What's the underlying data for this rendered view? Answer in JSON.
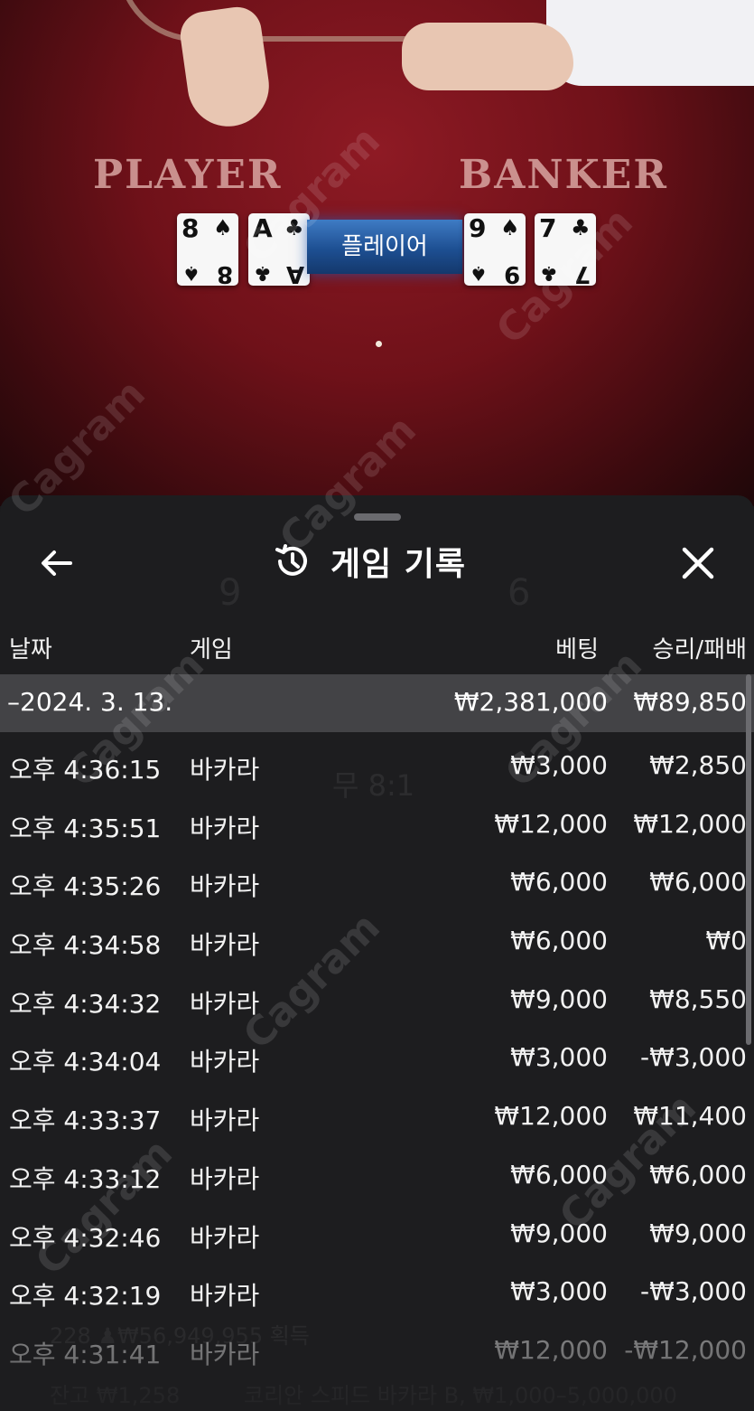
{
  "table": {
    "player_label": "PLAYER",
    "banker_label": "BANKER",
    "result_banner": "플레이어",
    "player_cards": [
      {
        "rank": "8",
        "suit": "♠"
      },
      {
        "rank": "A",
        "suit": "♣"
      }
    ],
    "banker_cards": [
      {
        "rank": "9",
        "suit": "♠"
      },
      {
        "rank": "7",
        "suit": "♣"
      }
    ],
    "watermark_text": "Cagram"
  },
  "sheet": {
    "title": "게임 기록",
    "icons": {
      "back": "arrow-left-icon",
      "history": "history-icon",
      "close": "close-icon"
    },
    "columns": {
      "date": "날짜",
      "game": "게임",
      "bet": "베팅",
      "result": "승리/패배"
    },
    "group": {
      "date": "–2024. 3. 13.",
      "bet": "₩2,381,000",
      "result": "₩89,850"
    },
    "rows": [
      {
        "time": "오후 4:36:15",
        "game": "바카라",
        "bet": "₩3,000",
        "result": "₩2,850"
      },
      {
        "time": "오후 4:35:51",
        "game": "바카라",
        "bet": "₩12,000",
        "result": "₩12,000"
      },
      {
        "time": "오후 4:35:26",
        "game": "바카라",
        "bet": "₩6,000",
        "result": "₩6,000"
      },
      {
        "time": "오후 4:34:58",
        "game": "바카라",
        "bet": "₩6,000",
        "result": "₩0"
      },
      {
        "time": "오후 4:34:32",
        "game": "바카라",
        "bet": "₩9,000",
        "result": "₩8,550"
      },
      {
        "time": "오후 4:34:04",
        "game": "바카라",
        "bet": "₩3,000",
        "result": "-₩3,000"
      },
      {
        "time": "오후 4:33:37",
        "game": "바카라",
        "bet": "₩12,000",
        "result": "₩11,400"
      },
      {
        "time": "오후 4:33:12",
        "game": "바카라",
        "bet": "₩6,000",
        "result": "₩6,000"
      },
      {
        "time": "오후 4:32:46",
        "game": "바카라",
        "bet": "₩9,000",
        "result": "₩9,000"
      },
      {
        "time": "오후 4:32:19",
        "game": "바카라",
        "bet": "₩3,000",
        "result": "-₩3,000"
      },
      {
        "time": "오후 4:31:41",
        "game": "바카라",
        "bet": "₩12,000",
        "result": "-₩12,000"
      }
    ],
    "background_ghost": {
      "player_score": "9",
      "banker_score": "6",
      "tie_payout": "무 8:1",
      "winners": "228 ♟₩56,949,955 획득",
      "balance": "잔고 ₩1,258",
      "table_name": "코리안 스피드 바카라 B, ₩1,000–5,000,000"
    }
  }
}
